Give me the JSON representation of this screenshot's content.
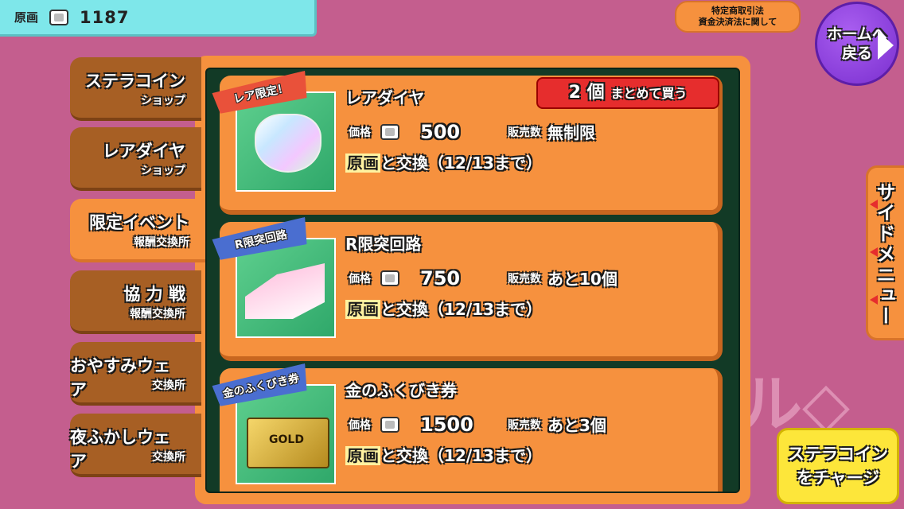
{
  "currency": {
    "label": "原画",
    "amount": "1187",
    "icon": "gem-icon"
  },
  "legal": {
    "line1": "特定商取引法",
    "line2": "資金決済法に関して"
  },
  "home": {
    "line1": "ホームへ",
    "line2": "戻る"
  },
  "tabs": [
    {
      "l1": "ステラコイン",
      "l2": "ショップ"
    },
    {
      "l1": "レアダイヤ",
      "l2": "ショップ"
    },
    {
      "l1": "限定イベント",
      "l2": "報酬交換所"
    },
    {
      "l1": "協 力 戦",
      "l2": "報酬交換所"
    },
    {
      "l1": "おやすみウェア",
      "l2": "交換所"
    },
    {
      "l1": "夜ふかしウェア",
      "l2": "交換所"
    }
  ],
  "items": [
    {
      "name": "レアダイヤ",
      "badge": "レア限定！",
      "price_label": "価格",
      "price": "500",
      "stock_label": "販売数",
      "stock": "無制限",
      "currency_hl": "原画",
      "exchange": "と交換（12/13まで）",
      "bulk_count": "2 個",
      "bulk_text": "まとめて買う"
    },
    {
      "name": "R限突回路",
      "badge": "R限突回路",
      "price_label": "価格",
      "price": "750",
      "stock_label": "販売数",
      "stock": "あと10個",
      "currency_hl": "原画",
      "exchange": "と交換（12/13まで）"
    },
    {
      "name": "金のふくびき券",
      "badge": "金のふくびき券",
      "price_label": "価格",
      "price": "1500",
      "stock_label": "販売数",
      "stock": "あと3個",
      "currency_hl": "原画",
      "exchange": "と交換（12/13まで）",
      "ticket_text": "GOLD"
    }
  ],
  "side_menu": "サイドメニュー",
  "charge": {
    "line1": "ステラコイン",
    "line2": "をチャージ"
  },
  "colors": {
    "background": "#c45e8e",
    "panel": "#f6913e",
    "accent_red": "#e62d2d",
    "currency_bar": "#7ee7ea"
  }
}
